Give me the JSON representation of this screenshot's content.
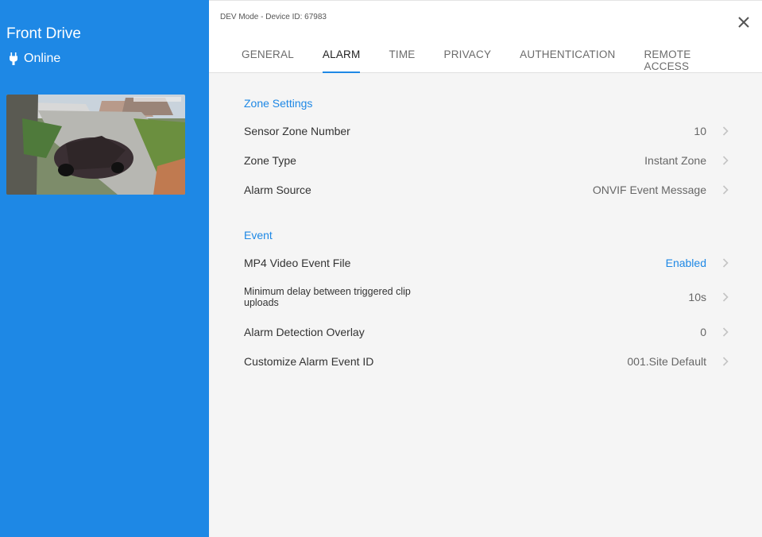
{
  "sidebar": {
    "device_name": "Front Drive",
    "status": "Online",
    "icon": "plug-icon"
  },
  "header": {
    "device_id": "DEV Mode - Device ID: 67983",
    "tabs": [
      {
        "label": "GENERAL"
      },
      {
        "label": "ALARM",
        "active": true
      },
      {
        "label": "TIME"
      },
      {
        "label": "PRIVACY"
      },
      {
        "label": "AUTHENTICATION"
      },
      {
        "label": "REMOTE ACCESS"
      }
    ]
  },
  "zone_settings": {
    "title": "Zone Settings",
    "rows": [
      {
        "label": "Sensor Zone Number",
        "value": "10"
      },
      {
        "label": "Zone Type",
        "value": "Instant Zone"
      },
      {
        "label": "Alarm Source",
        "value": "ONVIF Event Message"
      }
    ]
  },
  "event": {
    "title": "Event",
    "rows": [
      {
        "label": "MP4 Video Event File",
        "value": "Enabled"
      },
      {
        "label": "Minimum delay between triggered clip uploads",
        "value": "10s"
      },
      {
        "label": "Alarm Detection Overlay",
        "value": "0"
      },
      {
        "label": "Customize Alarm Event ID",
        "value": "001.Site Default"
      }
    ]
  },
  "colors": {
    "accent": "#1e88e5",
    "sidebar_bg": "#1e88e5",
    "content_bg": "#f5f5f5"
  }
}
